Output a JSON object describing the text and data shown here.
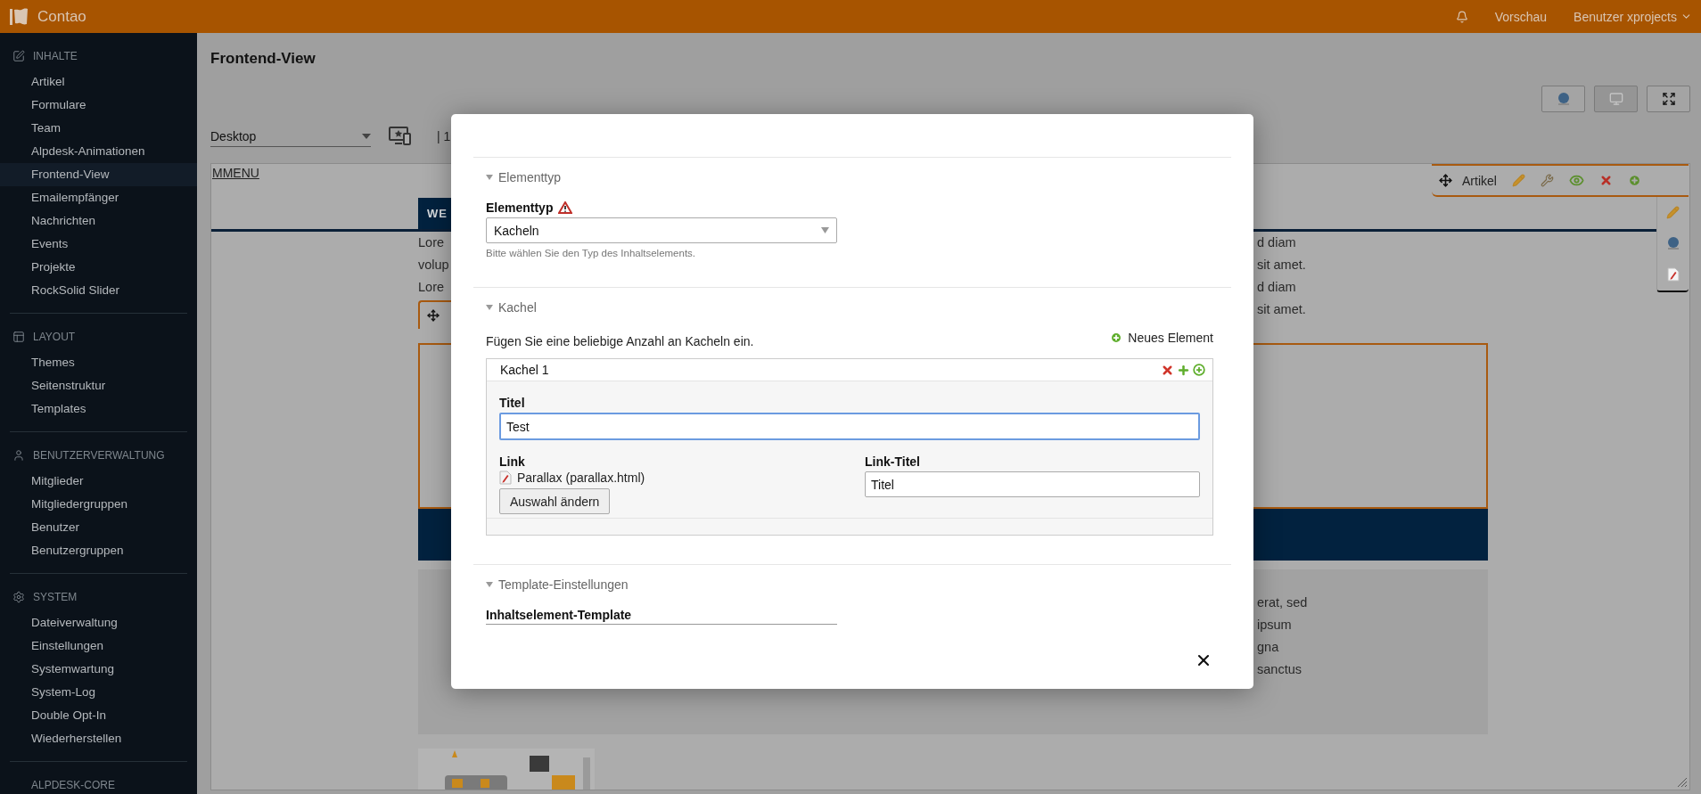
{
  "topbar": {
    "brand": "Contao",
    "preview_link": "Vorschau",
    "user_menu": "Benutzer xprojects"
  },
  "sidebar": {
    "groups": [
      {
        "title": "INHALTE",
        "kind": "edit",
        "items": [
          {
            "label": "Artikel",
            "selected": false
          },
          {
            "label": "Formulare",
            "selected": false
          },
          {
            "label": "Team",
            "selected": false
          },
          {
            "label": "Alpdesk-Animationen",
            "selected": false
          },
          {
            "label": "Frontend-View",
            "selected": true
          },
          {
            "label": "Emailempfänger",
            "selected": false
          },
          {
            "label": "Nachrichten",
            "selected": false
          },
          {
            "label": "Events",
            "selected": false
          },
          {
            "label": "Projekte",
            "selected": false
          },
          {
            "label": "RockSolid Slider",
            "selected": false
          }
        ]
      },
      {
        "title": "LAYOUT",
        "kind": "layout",
        "items": [
          {
            "label": "Themes",
            "selected": false
          },
          {
            "label": "Seitenstruktur",
            "selected": false
          },
          {
            "label": "Templates",
            "selected": false
          }
        ]
      },
      {
        "title": "BENUTZERVERWALTUNG",
        "kind": "users",
        "items": [
          {
            "label": "Mitglieder",
            "selected": false
          },
          {
            "label": "Mitgliedergruppen",
            "selected": false
          },
          {
            "label": "Benutzer",
            "selected": false
          },
          {
            "label": "Benutzergruppen",
            "selected": false
          }
        ]
      },
      {
        "title": "SYSTEM",
        "kind": "system",
        "items": [
          {
            "label": "Dateiverwaltung",
            "selected": false
          },
          {
            "label": "Einstellungen",
            "selected": false
          },
          {
            "label": "Systemwartung",
            "selected": false
          },
          {
            "label": "System-Log",
            "selected": false
          },
          {
            "label": "Double Opt-In",
            "selected": false
          },
          {
            "label": "Wiederherstellen",
            "selected": false
          }
        ]
      },
      {
        "title": "ALPDESK-CORE",
        "kind": "plain"
      }
    ]
  },
  "page": {
    "title": "Frontend-View",
    "view_buttons": [
      {
        "kind": "member",
        "selected": false
      },
      {
        "kind": "desktop",
        "selected": true
      },
      {
        "kind": "fullscreen",
        "selected": false
      }
    ],
    "device_select": {
      "value": "Desktop"
    },
    "width_readout": "| 1"
  },
  "preview": {
    "menu_link": "MMENU",
    "nav_tab": "WE",
    "text_left": [
      "Lore",
      "volup",
      "Lore"
    ],
    "text_right": [
      "d diam",
      "sit amet.",
      "d diam",
      "sit amet."
    ],
    "article_toolbar": {
      "label": "Artikel"
    },
    "lower_text_right": [
      "erat, sed",
      "ipsum",
      "gna",
      "sanctus"
    ],
    "image": {
      "kind": "picture"
    }
  },
  "modal": {
    "sections": [
      {
        "legend": "Elementtyp",
        "expanded": true,
        "kind": "type"
      },
      {
        "legend": "Kachel",
        "expanded": true,
        "kind": "tiles"
      },
      {
        "legend": "Template-Einstellungen",
        "expanded": true,
        "kind": "template"
      }
    ],
    "type_field": {
      "label": "Elementtyp",
      "value": "Kacheln",
      "hint": "Bitte wählen Sie den Typ des Inhaltselements."
    },
    "tiles": {
      "intro": "Fügen Sie eine beliebige Anzahl an Kacheln ein.",
      "add_label": "Neues Element",
      "items": [
        {
          "title": "Kachel 1",
          "title_label": "Titel",
          "title_value": "Test",
          "focused": true,
          "link_label": "Link",
          "link_page": "Parallax (parallax.html)",
          "change_button": "Auswahl ändern",
          "link_title_label": "Link-Titel",
          "link_title_value": "Titel"
        }
      ]
    },
    "template_field": {
      "label": "Inhaltselement-Template"
    }
  }
}
